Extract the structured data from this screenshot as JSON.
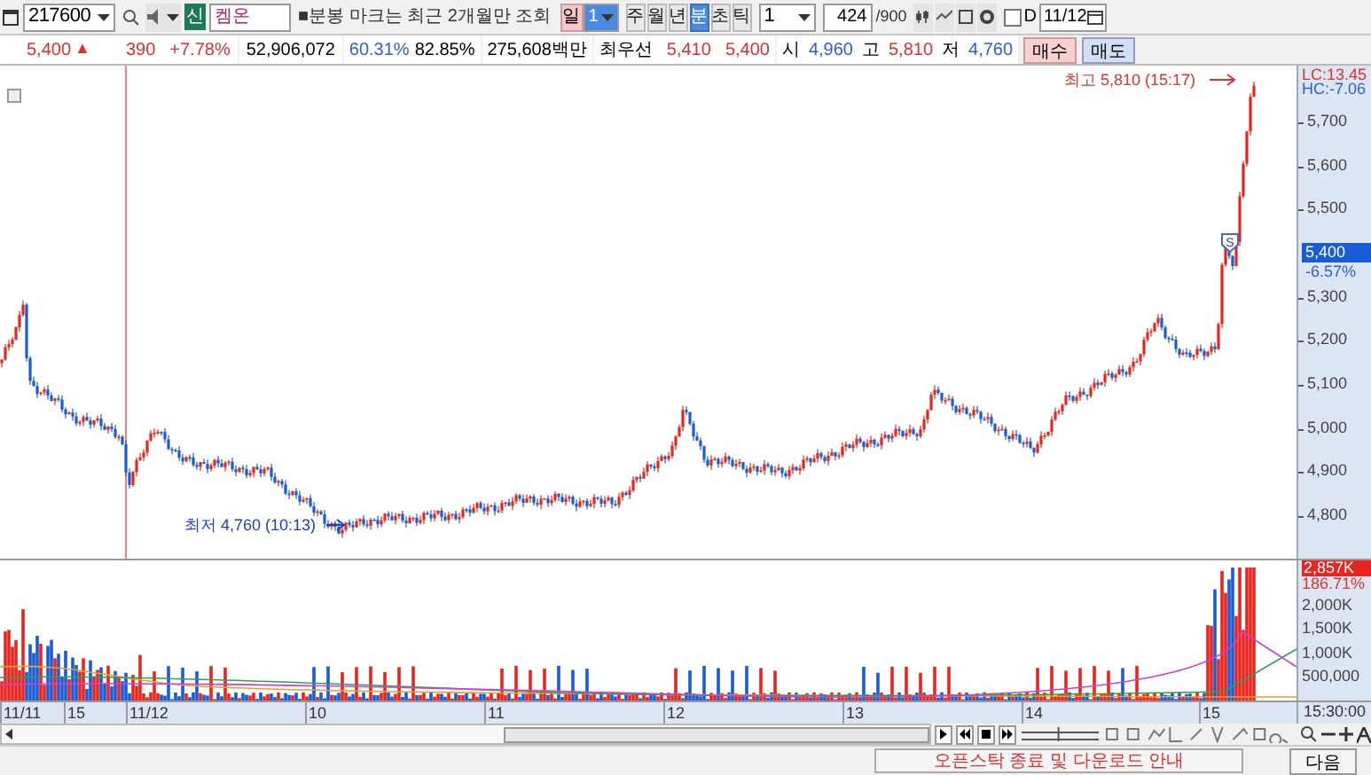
{
  "toolbar": {
    "code": "217600",
    "badge": "신",
    "name": "켐온",
    "notice": "■분봉 마크는 최근 2개월만 조회",
    "day_button": {
      "label": "일",
      "count": "1"
    },
    "period_tabs": [
      {
        "label": "주",
        "selected": false
      },
      {
        "label": "월",
        "selected": false
      },
      {
        "label": "년",
        "selected": false
      },
      {
        "label": "분",
        "selected": true
      },
      {
        "label": "초",
        "selected": false
      },
      {
        "label": "틱",
        "selected": false
      }
    ],
    "interval": "1",
    "bar_count": "424",
    "bar_max": "/900",
    "d_checkbox": {
      "label": "D",
      "checked": false
    },
    "date": "11/12"
  },
  "quote": {
    "price": "5,400",
    "arrow": "▲",
    "change": "390",
    "change_pct": "+7.78%",
    "volume": "52,906,072",
    "ratio1": "60.31%",
    "ratio2": "82.85%",
    "amount": "275,608백만",
    "best_label": "최우선",
    "best_ask": "5,410",
    "best_bid": "5,400",
    "open_label": "시",
    "open": "4,960",
    "high_label": "고",
    "high": "5,810",
    "low_label": "저",
    "low": "4,760",
    "buy": "매수",
    "sell": "매도"
  },
  "chart": {
    "high_note": "최고 5,810 (15:17)",
    "low_note": "최저 4,760 (10:13)",
    "lc": "LC:13.45",
    "hc": "HC:-7.06",
    "signal_mark": "S",
    "price_ticks": [
      "5,700",
      "5,600",
      "5,500",
      "5,300",
      "5,200",
      "5,100",
      "5,000",
      "4,900",
      "4,800"
    ],
    "current_price": "5,400",
    "current_pct": "-6.57%",
    "volume_marker": "2,857K",
    "volume_pct": "186.71%",
    "volume_ticks": [
      "2,000K",
      "1,500K",
      "1,000K",
      "500,000"
    ],
    "time_labels": [
      "11/11",
      "15",
      "11/12",
      "10",
      "11",
      "12",
      "13",
      "14",
      "15"
    ],
    "time_end": "15:30:00"
  },
  "footer": {
    "notice": "오픈스탁 종료 및 다운로드 안내",
    "next": "다음"
  }
}
